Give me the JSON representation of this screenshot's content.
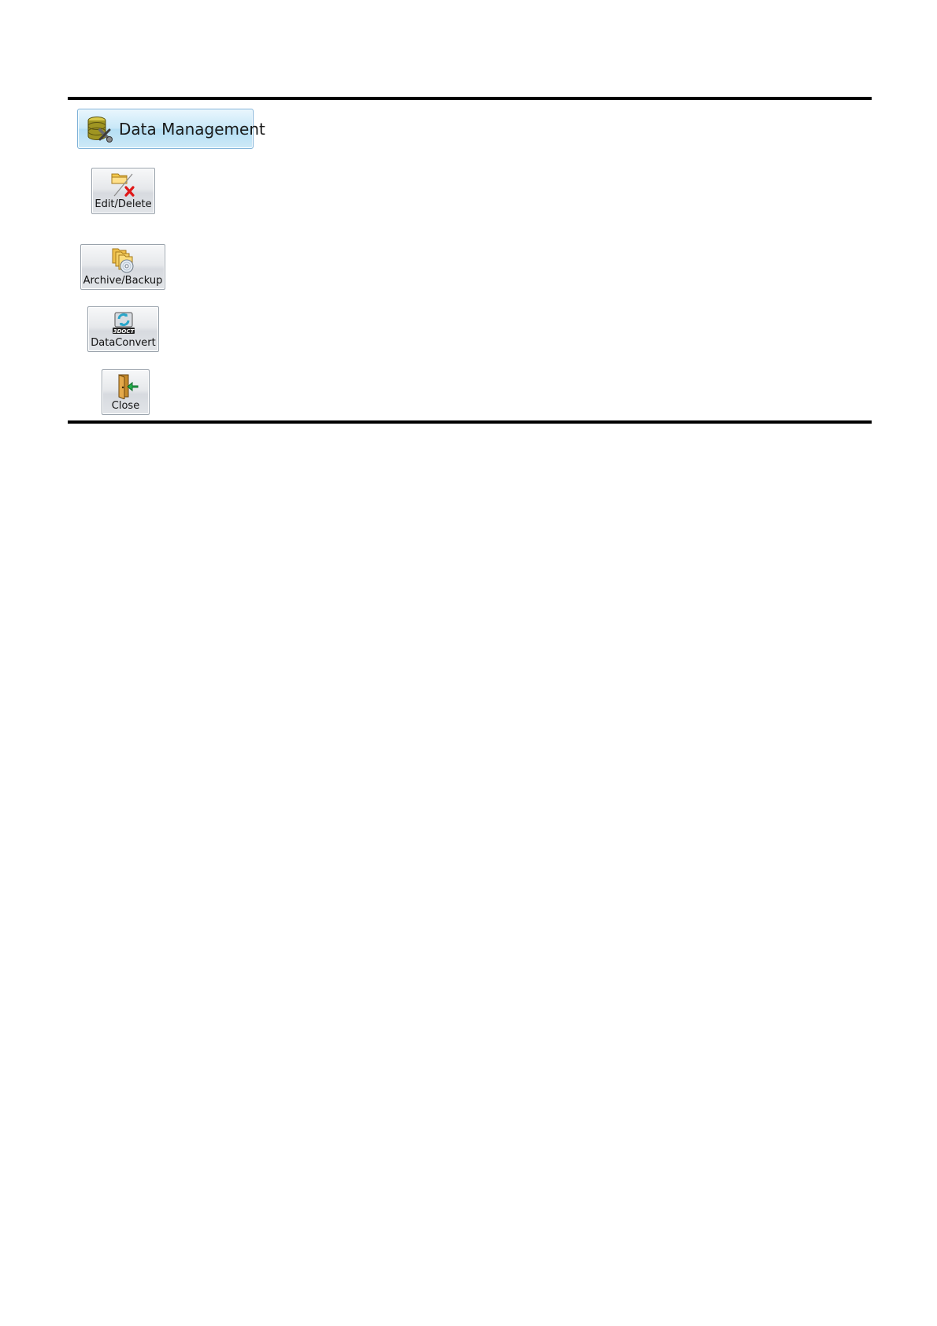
{
  "main_button": {
    "label": "Data Management",
    "icon": "database-tools-icon"
  },
  "toolbar_buttons": [
    {
      "label": "Edit/Delete",
      "icon": "folder-edit-delete-icon"
    },
    {
      "label": "Archive/Backup",
      "icon": "folders-disc-icon"
    },
    {
      "label": "DataConvert",
      "icon": "3doct-convert-icon",
      "icon_text": "3DOCT"
    },
    {
      "label": "Close",
      "icon": "door-exit-icon"
    }
  ],
  "colors": {
    "main_button_bg": "#c9e8f8",
    "main_button_border": "#7fb2d8",
    "tool_button_bg": "#e6e8eb",
    "rule": "#000000",
    "delete_x": "#e01818",
    "exit_arrow": "#22b14c"
  }
}
